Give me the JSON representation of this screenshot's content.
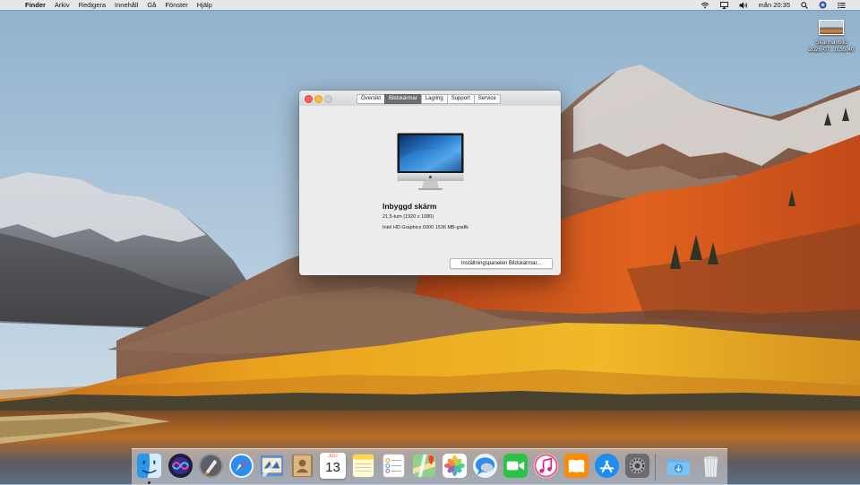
{
  "menubar": {
    "apple_glyph": "",
    "items": [
      "Finder",
      "Arkiv",
      "Redigera",
      "Innehåll",
      "Gå",
      "Fönster",
      "Hjälp"
    ],
    "clock": "mån 20:35",
    "status_icons": [
      "wifi-icon",
      "airplay-icon",
      "volume-icon",
      "search-icon",
      "siri-icon",
      "notification-center-icon"
    ]
  },
  "desktop": {
    "item_label_line1": "Skärmavbild",
    "item_label_line2": "2026-07...0.35.40"
  },
  "window": {
    "tabs": [
      "Översikt",
      "Bildskärmar",
      "Lagring",
      "Support",
      "Service"
    ],
    "active_tab": "Bildskärmar",
    "display_name": "Inbyggd skärm",
    "resolution": "21,5-tum (1920 x 1080)",
    "graphics": "Intel HD Graphics 6000 1536 MB-grafik",
    "prefs_button": "Inställningspanelen Bildskärmar..."
  },
  "dock": {
    "apps": [
      {
        "name": "Finder",
        "icon": "finder-icon"
      },
      {
        "name": "Siri",
        "icon": "siri-icon"
      },
      {
        "name": "Launchpad",
        "icon": "launchpad-icon"
      },
      {
        "name": "Safari",
        "icon": "safari-icon"
      },
      {
        "name": "Mail",
        "icon": "mail-icon"
      },
      {
        "name": "Kontakter",
        "icon": "contacts-icon"
      },
      {
        "name": "Kalender",
        "icon": "calendar-icon"
      },
      {
        "name": "Anteckningar",
        "icon": "notes-icon"
      },
      {
        "name": "Påminnelser",
        "icon": "reminders-icon"
      },
      {
        "name": "Kartor",
        "icon": "maps-icon"
      },
      {
        "name": "Bilder",
        "icon": "photos-icon"
      },
      {
        "name": "Meddelanden",
        "icon": "messages-icon"
      },
      {
        "name": "FaceTime",
        "icon": "facetime-icon"
      },
      {
        "name": "iTunes",
        "icon": "itunes-icon"
      },
      {
        "name": "iBooks",
        "icon": "ibooks-icon"
      },
      {
        "name": "App Store",
        "icon": "appstore-icon"
      },
      {
        "name": "Systeminställningar",
        "icon": "system-preferences-icon"
      },
      {
        "name": "Hämtade filer",
        "icon": "downloads-folder-icon"
      },
      {
        "name": "Papperskorg",
        "icon": "trash-icon"
      }
    ],
    "calendar_month": "JULI",
    "calendar_day": "13"
  }
}
